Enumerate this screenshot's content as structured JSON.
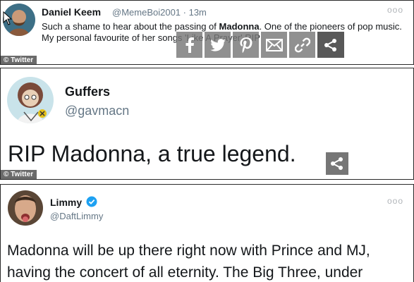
{
  "source_badge": "© Twitter",
  "tweets": [
    {
      "name": "Daniel Keem",
      "handle": "@MemeBoi2001",
      "time": "· 13m",
      "text_before": "Such a shame to hear about the passing of ",
      "text_bold": "Madonna",
      "text_after": ". One of the pioneers of pop music. My personal favourite of her songs 'Like A Prayer' RIP",
      "more": "ooo"
    },
    {
      "name": "Guffers",
      "handle": "@gavmacn",
      "text": "RIP Madonna, a true legend."
    },
    {
      "name": "Limmy",
      "handle": "@DaftLimmy",
      "text": "Madonna will be up there right now with Prince and MJ, having the concert of all eternity. The Big Three, under",
      "more": "ooo"
    }
  ],
  "share_bar": {
    "icons": [
      "facebook-icon",
      "twitter-icon",
      "pinterest-icon",
      "email-icon",
      "link-icon",
      "share-icon"
    ]
  },
  "colors": {
    "handle": "#657786",
    "verified": "#1da1f2",
    "badge_bg": "#6b6b6b"
  }
}
